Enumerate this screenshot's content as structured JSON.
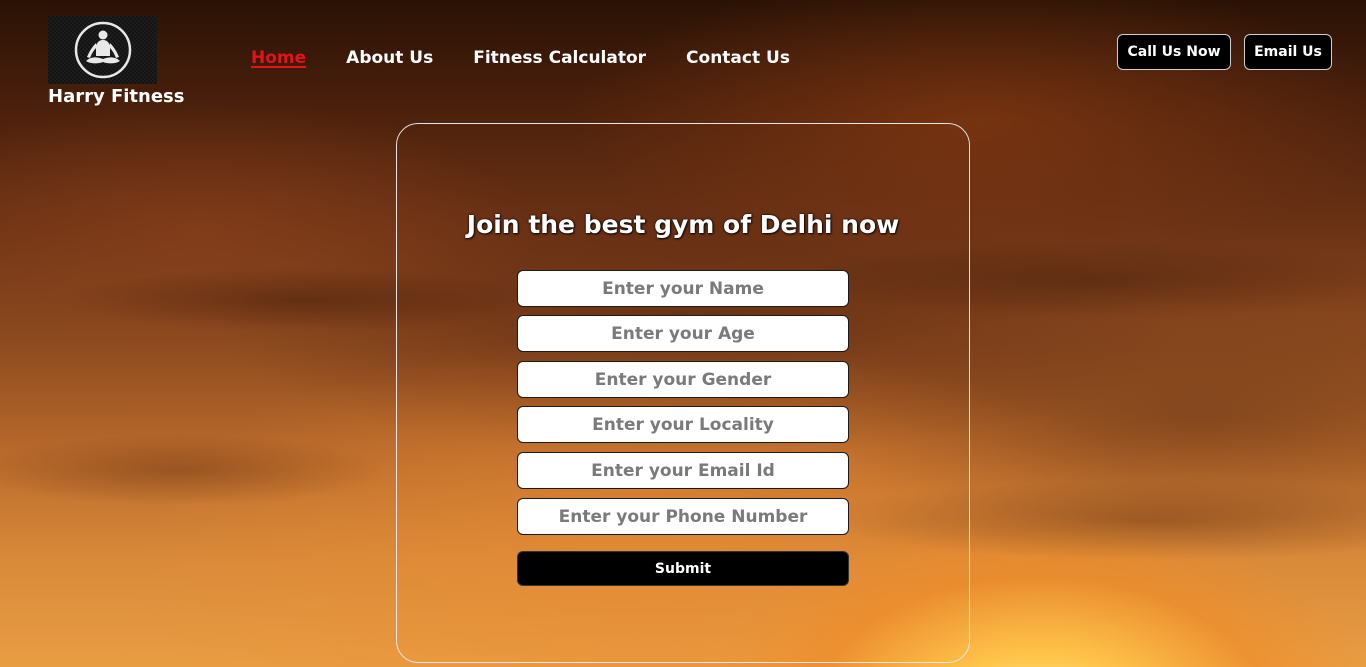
{
  "brand": {
    "name": "Harry Fitness",
    "logo_icon": "meditation-icon"
  },
  "nav": {
    "items": [
      {
        "label": "Home",
        "active": true
      },
      {
        "label": "About Us",
        "active": false
      },
      {
        "label": "Fitness Calculator",
        "active": false
      },
      {
        "label": "Contact Us",
        "active": false
      }
    ]
  },
  "header_buttons": {
    "call": "Call Us Now",
    "email": "Email Us"
  },
  "form": {
    "title": "Join the best gym of Delhi now",
    "fields": [
      {
        "placeholder": "Enter your Name",
        "value": ""
      },
      {
        "placeholder": "Enter your Age",
        "value": ""
      },
      {
        "placeholder": "Enter your Gender",
        "value": ""
      },
      {
        "placeholder": "Enter your Locality",
        "value": ""
      },
      {
        "placeholder": "Enter your Email Id",
        "value": ""
      },
      {
        "placeholder": "Enter your Phone Number",
        "value": ""
      }
    ],
    "submit_label": "Submit"
  },
  "colors": {
    "active_nav": "#e5121b",
    "button_bg": "#000000",
    "text": "#ffffff"
  }
}
